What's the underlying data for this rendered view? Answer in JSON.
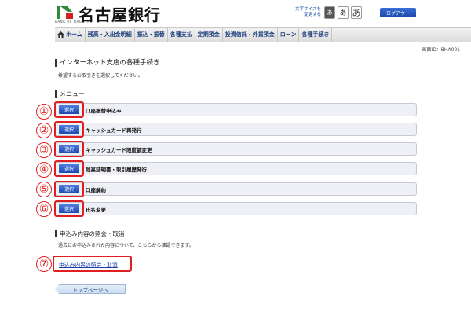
{
  "header": {
    "bank_name": "名古屋銀行",
    "logo_sub": "BANK OF NAGOYA",
    "font_size_label": "文字サイズを\n変更する",
    "font_sizes": [
      "あ",
      "あ",
      "あ"
    ],
    "logout_label": "ログアウト"
  },
  "nav": {
    "items": [
      "ホーム",
      "残高・入出金明細",
      "振込・振替",
      "各種支払",
      "定期預金",
      "投資信託・外貨預金",
      "ローン",
      "各種手続き"
    ]
  },
  "screen_id": "画面ID：BHA001",
  "page": {
    "title": "インターネット支店の各種手続き",
    "description": "希望するお取引きを選択してください。"
  },
  "menu": {
    "heading": "メニュー",
    "select_label": "選択",
    "items": [
      {
        "number": "①",
        "label": "口座振替申込み"
      },
      {
        "number": "②",
        "label": "キャッシュカード再発行"
      },
      {
        "number": "③",
        "label": "キャッシュカード限度額変更"
      },
      {
        "number": "④",
        "label": "残高証明書・取引履歴発行"
      },
      {
        "number": "⑤",
        "label": "口座解約"
      },
      {
        "number": "⑥",
        "label": "氏名変更"
      }
    ]
  },
  "inquiry": {
    "heading": "申込み内容の照会・取消",
    "description": "過去にお申込みされた内容について、こちらから確認できます。",
    "link_label": "申込み内容の照会・取消",
    "number": "⑦"
  },
  "footer": {
    "top_button_label": "トップページへ"
  },
  "colors": {
    "accent_blue": "#1c48b0",
    "highlight_red": "#e02020",
    "logo_green": "#2e8b3d",
    "logo_red": "#d32020"
  }
}
